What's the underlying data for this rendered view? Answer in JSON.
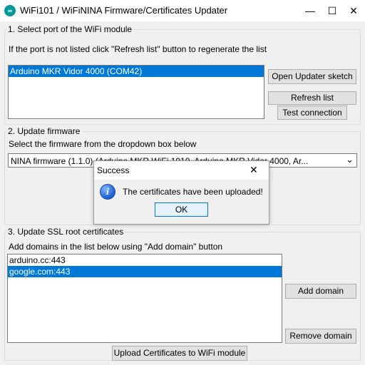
{
  "window": {
    "title": "WiFi101 / WiFiNINA Firmware/Certificates Updater",
    "controls": {
      "minimize": "—",
      "maximize": "☐",
      "close": "✕"
    }
  },
  "port_section": {
    "title": "1. Select port of the WiFi module",
    "hint": "If the port is not listed click \"Refresh list\" button to regenerate the list",
    "ports": [
      {
        "label": "Arduino MKR Vidor 4000 (COM42)",
        "selected": true
      }
    ],
    "buttons": {
      "open_sketch": "Open Updater sketch",
      "refresh": "Refresh list",
      "test": "Test connection"
    }
  },
  "firmware_section": {
    "title": "2. Update firmware",
    "hint": "Select the firmware from the dropdown box below",
    "selected_firmware": "NINA firmware (1.1.0) (Arduino MKR WiFi 1010, Arduino MKR Vidor 4000, Ar...",
    "dropdown_arrow": "⌄"
  },
  "ssl_section": {
    "title": "3. Update SSL root certificates",
    "hint": "Add domains in the list below using \"Add domain\" button",
    "domains": [
      {
        "label": "arduino.cc:443",
        "selected": false
      },
      {
        "label": "google.com:443",
        "selected": true
      }
    ],
    "buttons": {
      "add_domain": "Add domain",
      "remove_domain": "Remove domain",
      "upload": "Upload Certificates to WiFi module"
    }
  },
  "dialog": {
    "title": "Success",
    "close": "✕",
    "icon": "info-icon",
    "message": "The certificates have been uploaded!",
    "ok_label": "OK"
  },
  "colors": {
    "selection": "#0078d7",
    "accent": "#00979c"
  }
}
